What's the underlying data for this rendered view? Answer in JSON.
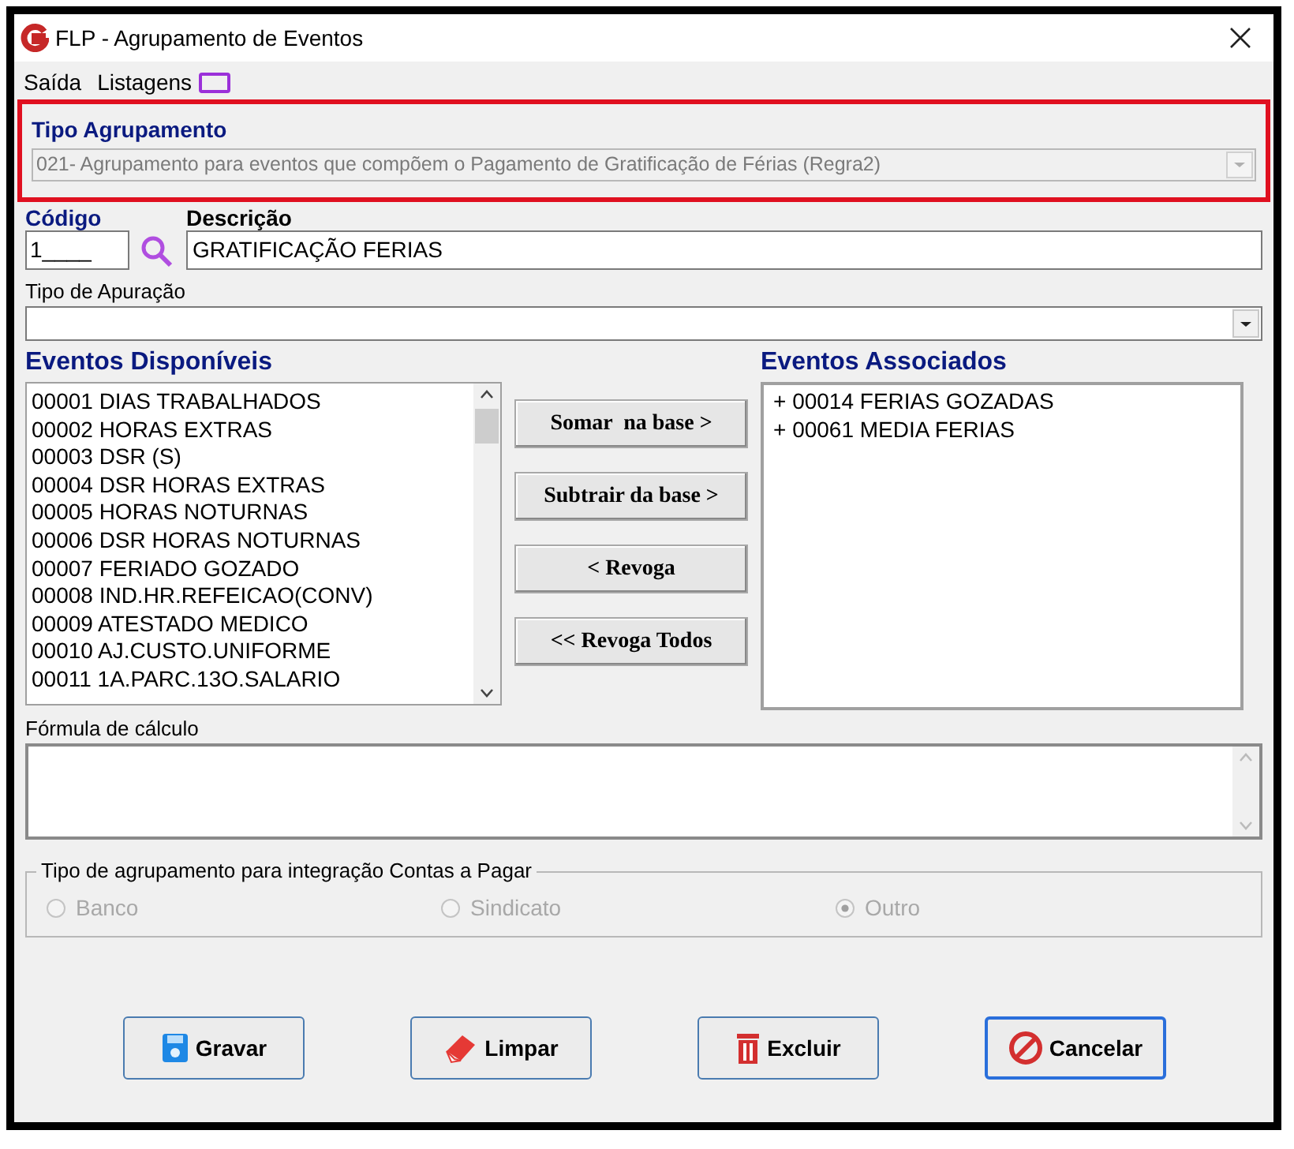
{
  "window": {
    "title": "FLP - Agrupamento de Eventos"
  },
  "menu": [
    "Saída",
    "Listagens"
  ],
  "tipo_agrupamento": {
    "label": "Tipo Agrupamento",
    "value": "021- Agrupamento para eventos que compõem o Pagamento de Gratificação de Férias (Regra2)",
    "disabled": true
  },
  "codigo": {
    "label": "Código",
    "value": "1____"
  },
  "descricao": {
    "label": "Descrição",
    "value": "GRATIFICAÇÃO FERIAS"
  },
  "tipo_apuracao": {
    "label": "Tipo de Apuração"
  },
  "eventos_disponiveis": {
    "title": "Eventos Disponíveis",
    "items": [
      "00001 DIAS TRABALHADOS",
      "00002 HORAS EXTRAS",
      "00003 DSR (S)",
      "00004 DSR HORAS EXTRAS",
      "00005 HORAS NOTURNAS",
      "00006 DSR HORAS NOTURNAS",
      "00007 FERIADO GOZADO",
      "00008 IND.HR.REFEICAO(CONV)",
      "00009 ATESTADO MEDICO",
      "00010 AJ.CUSTO.UNIFORME",
      "00011 1A.PARC.13O.SALARIO"
    ]
  },
  "actions": [
    "Somar  na base >",
    "Subtrair da base >",
    "< Revoga",
    "<< Revoga Todos"
  ],
  "eventos_associados": {
    "title": "Eventos Associados",
    "items": [
      "+ 00014 FERIAS GOZADAS",
      "+ 00061 MEDIA FERIAS"
    ]
  },
  "formula": {
    "label": "Fórmula de cálculo"
  },
  "integracao": {
    "title": "Tipo de agrupamento para integração Contas a Pagar",
    "options": [
      {
        "label": "Banco",
        "selected": false,
        "disabled": true
      },
      {
        "label": "Sindicato",
        "selected": false,
        "disabled": true
      },
      {
        "label": "Outro",
        "selected": true,
        "disabled": true
      }
    ]
  },
  "buttons": [
    {
      "kind": "save",
      "label": "Gravar"
    },
    {
      "kind": "clear",
      "label": "Limpar"
    },
    {
      "kind": "delete",
      "label": "Excluir"
    },
    {
      "kind": "cancel",
      "label": "Cancelar",
      "default": true
    }
  ]
}
